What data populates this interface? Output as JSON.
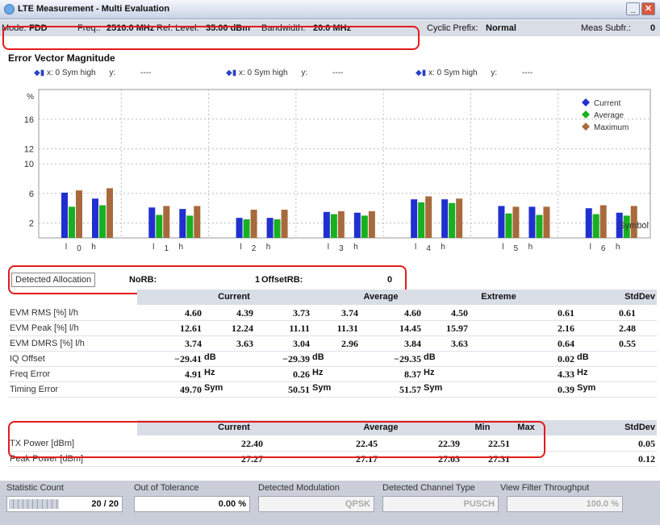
{
  "window": {
    "title": "LTE Measurement - Multi Evaluation"
  },
  "modebar": {
    "mode_label": "Mode:",
    "mode_value": "FDD",
    "freq_label": "Freq.:",
    "freq_value": "2510.0 MHz",
    "ref_label": "Ref. Level:",
    "ref_value": "35.00 dBm",
    "bw_label": "Bandwidth:",
    "bw_value": "20.0 MHz",
    "cp_label": "Cyclic Prefix:",
    "cp_value": "Normal",
    "subfr_label": "Meas Subfr.:",
    "subfr_value": "0"
  },
  "section_title": "Error Vector Magnitude",
  "markers": [
    {
      "text": "x: 0 Sym high",
      "ylabel": "y:",
      "yval": "----"
    },
    {
      "text": "x: 0 Sym high",
      "ylabel": "y:",
      "yval": "----"
    },
    {
      "text": "x: 0 Sym high",
      "ylabel": "y:",
      "yval": "----"
    }
  ],
  "chart_data": {
    "type": "bar",
    "ylabel": "%",
    "xlabel": "Symbol",
    "ylim": [
      0,
      20
    ],
    "yticks": [
      "2",
      "6",
      "10",
      "12",
      "16"
    ],
    "grid": true,
    "legend_position": "top-right",
    "groups": [
      {
        "symbol": "0",
        "low_label": "l",
        "high_label": "h"
      },
      {
        "symbol": "1",
        "low_label": "l",
        "high_label": "h"
      },
      {
        "symbol": "2",
        "low_label": "l",
        "high_label": "h"
      },
      {
        "symbol": "3",
        "low_label": "l",
        "high_label": "h"
      },
      {
        "symbol": "4",
        "low_label": "l",
        "high_label": "h"
      },
      {
        "symbol": "5",
        "low_label": "l",
        "high_label": "h"
      },
      {
        "symbol": "6",
        "low_label": "l",
        "high_label": "h"
      }
    ],
    "series": [
      {
        "name": "Current",
        "color": "#2030d0",
        "values": [
          6.1,
          5.3,
          4.1,
          3.9,
          2.7,
          2.7,
          3.5,
          3.4,
          5.2,
          5.2,
          4.3,
          4.2,
          4.0,
          3.4
        ]
      },
      {
        "name": "Average",
        "color": "#18b020",
        "values": [
          4.2,
          4.4,
          3.1,
          3.0,
          2.5,
          2.5,
          3.2,
          3.0,
          4.8,
          4.7,
          3.3,
          3.1,
          3.2,
          3.0
        ]
      },
      {
        "name": "Maximum",
        "color": "#a86a3c",
        "values": [
          6.4,
          6.7,
          4.3,
          4.3,
          3.8,
          3.8,
          3.6,
          3.6,
          5.6,
          5.3,
          4.2,
          4.2,
          4.4,
          4.3
        ]
      }
    ]
  },
  "allocation": {
    "button_label": "Detected Allocation",
    "norb_label": "NoRB:",
    "norb_value": "1",
    "offset_label": "OffsetRB:",
    "offset_value": "0"
  },
  "table1": {
    "headers": [
      "Current",
      "Average",
      "Extreme",
      "StdDev"
    ],
    "rows": [
      {
        "label": "EVM RMS [%] l/h",
        "values": [
          "4.60",
          "4.39",
          "3.73",
          "3.74",
          "4.60",
          "4.50",
          "0.61",
          "0.61"
        ]
      },
      {
        "label": "EVM Peak [%] l/h",
        "values": [
          "12.61",
          "12.24",
          "11.11",
          "11.31",
          "14.45",
          "15.97",
          "2.16",
          "2.48"
        ]
      },
      {
        "label": "EVM DMRS [%] l/h",
        "values": [
          "3.74",
          "3.63",
          "3.04",
          "2.96",
          "3.84",
          "3.63",
          "0.64",
          "0.55"
        ]
      },
      {
        "label": "IQ Offset",
        "values": [
          "−29.41",
          "−29.39",
          "−29.35",
          "0.02"
        ],
        "unit": "dB"
      },
      {
        "label": "Freq Error",
        "values": [
          "4.91",
          "0.26",
          "8.37",
          "4.33"
        ],
        "unit": "Hz"
      },
      {
        "label": "Timing Error",
        "values": [
          "49.70",
          "50.51",
          "51.57",
          "0.39"
        ],
        "unit": "Sym"
      }
    ]
  },
  "table2": {
    "headers": [
      "Current",
      "Average",
      "Min",
      "Max",
      "StdDev"
    ],
    "rows": [
      {
        "label": "TX Power [dBm]",
        "values": [
          "22.40",
          "22.45",
          "22.39",
          "22.51",
          "0.05"
        ]
      },
      {
        "label": "Peak Power [dBm]",
        "values": [
          "27.27",
          "27.17",
          "27.03",
          "27.31",
          "0.12"
        ]
      }
    ]
  },
  "bottom": {
    "stat_label": "Statistic Count",
    "stat_value": "20 / 20",
    "tol_label": "Out of Tolerance",
    "tol_value": "0.00 %",
    "mod_label": "Detected Modulation",
    "mod_value": "QPSK",
    "chan_label": "Detected Channel Type",
    "chan_value": "PUSCH",
    "view_label": "View Filter Throughput",
    "view_value": "100.0 %"
  }
}
